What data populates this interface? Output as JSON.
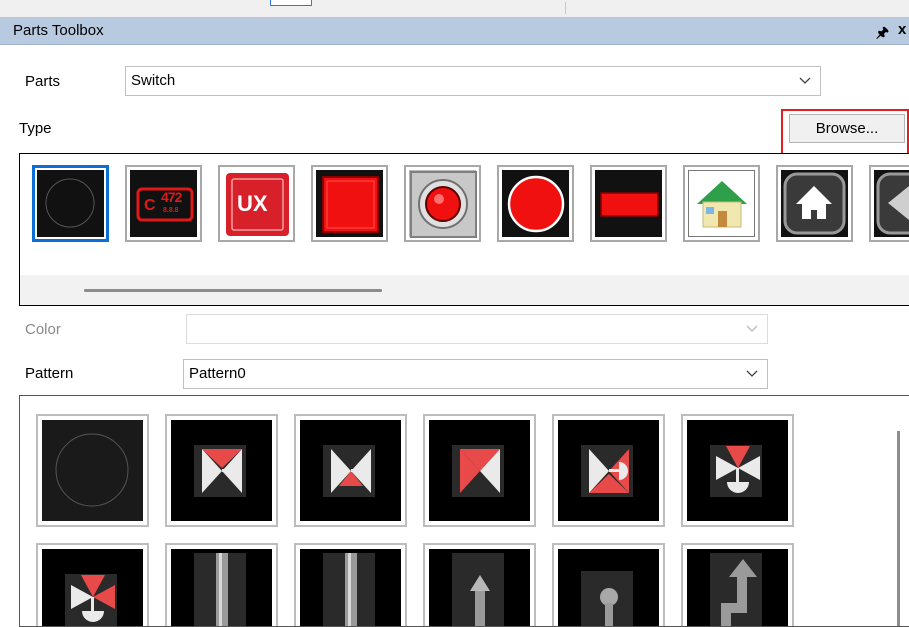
{
  "panel": {
    "title": "Parts Toolbox"
  },
  "parts": {
    "label": "Parts",
    "value": "Switch"
  },
  "type": {
    "label": "Type",
    "browse_label": "Browse...",
    "selected_index": 0
  },
  "color": {
    "label": "Color",
    "value": ""
  },
  "pattern": {
    "label": "Pattern",
    "value": "Pattern0"
  },
  "type_items": [
    "circle-outline",
    "digital-counter",
    "ux-button",
    "red-square-button",
    "red-lamp-metal-bezel",
    "red-round-button",
    "red-flat-button",
    "home-icon-color",
    "home-icon-black",
    "diamond-arrow"
  ],
  "counter_text": {
    "big": "472",
    "small": "8.8.8"
  },
  "ux_text": "UX",
  "pattern_items": [
    "circle-outline",
    "valve-handle",
    "valve-gray-handle",
    "valve-red",
    "valve-round-actuator",
    "valve-down-actuator",
    "valve-red-down-actuator",
    "pipe-vertical",
    "pipe-vertical-2",
    "pipe-arrow-up",
    "pipe-knob",
    "pipe-bend-arrow"
  ]
}
